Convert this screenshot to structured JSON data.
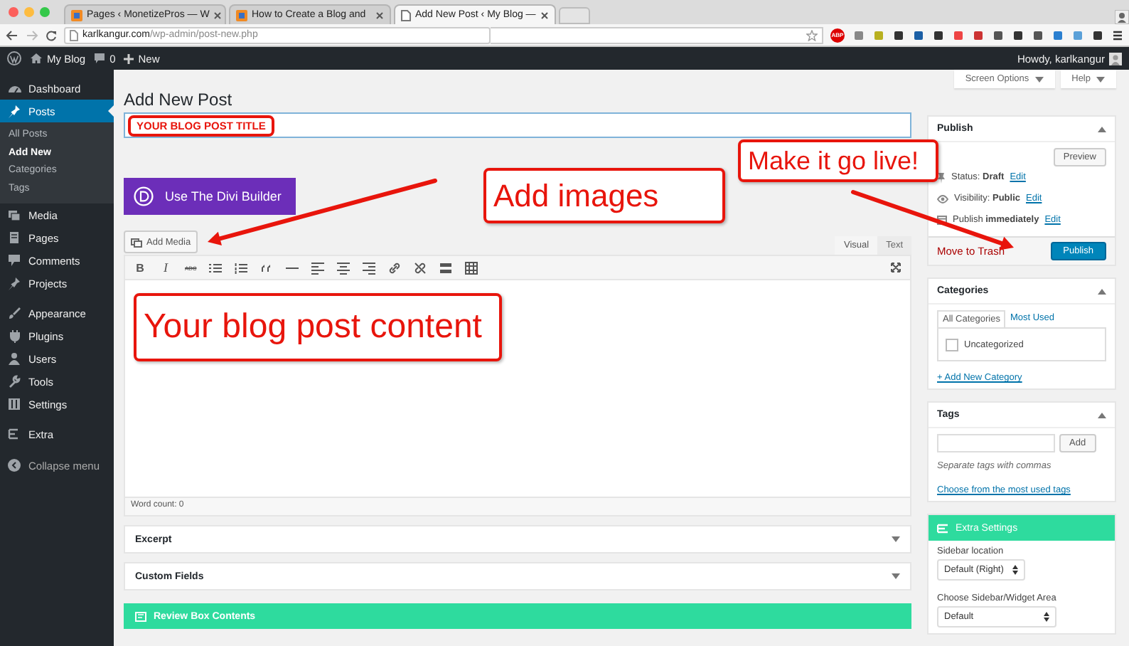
{
  "browser": {
    "tabs": [
      {
        "label": "Pages ‹ MonetizePros — W",
        "selected": false
      },
      {
        "label": "How to Create a Blog and",
        "selected": false
      },
      {
        "label": "Add New Post ‹ My Blog —",
        "selected": true
      }
    ],
    "url_host": "karlkangur.com",
    "url_path": "/wp-admin/post-new.php",
    "badge": "ABP"
  },
  "admin_bar": {
    "site": "My Blog",
    "comments": "0",
    "new": "New",
    "greeting": "Howdy, karlkangur"
  },
  "sidebar": {
    "items": [
      {
        "label": "Dashboard",
        "selected": false
      },
      {
        "label": "Posts",
        "selected": true,
        "children": [
          {
            "label": "All Posts",
            "selected": false
          },
          {
            "label": "Add New",
            "selected": true
          },
          {
            "label": "Categories",
            "selected": false
          },
          {
            "label": "Tags",
            "selected": false
          }
        ]
      },
      {
        "label": "Media",
        "selected": false
      },
      {
        "label": "Pages",
        "selected": false
      },
      {
        "label": "Comments",
        "selected": false
      },
      {
        "label": "Projects",
        "selected": false
      },
      {
        "label": "Appearance",
        "selected": false
      },
      {
        "label": "Plugins",
        "selected": false
      },
      {
        "label": "Users",
        "selected": false
      },
      {
        "label": "Tools",
        "selected": false
      },
      {
        "label": "Settings",
        "selected": false
      },
      {
        "label": "Extra",
        "selected": false
      }
    ],
    "collapse": "Collapse menu"
  },
  "screen_meta": [
    "Screen Options",
    "Help"
  ],
  "page_title": "Add New Post",
  "divi_button": "Use The Divi Builder",
  "add_media": "Add Media",
  "editor_tabs": [
    {
      "label": "Visual",
      "selected": true
    },
    {
      "label": "Text",
      "selected": false
    }
  ],
  "toolbar": [
    {
      "kind": "bold",
      "label": "B"
    },
    {
      "kind": "italic",
      "label": "I"
    },
    {
      "kind": "strike",
      "label": "ABC"
    },
    {
      "kind": "bullets"
    },
    {
      "kind": "numbers"
    },
    {
      "kind": "quote"
    },
    {
      "kind": "rule"
    },
    {
      "kind": "align-left"
    },
    {
      "kind": "align-center"
    },
    {
      "kind": "align-right"
    },
    {
      "kind": "link"
    },
    {
      "kind": "unlink"
    },
    {
      "kind": "more"
    },
    {
      "kind": "sink"
    }
  ],
  "word_count": "Word count: 0",
  "metaboxes": [
    {
      "kind": "plain",
      "title": "Excerpt"
    },
    {
      "kind": "plain",
      "title": "Custom Fields"
    },
    {
      "kind": "accent",
      "title": "Review Box Contents"
    }
  ],
  "publish": {
    "title": "Publish",
    "preview": "Preview",
    "rows": [
      {
        "text": "Status: **Draft**",
        "link": "Edit"
      },
      {
        "text": "Visibility: **Public**",
        "link": "Edit"
      },
      {
        "text": "Publish **immediately**",
        "link": "Edit"
      }
    ],
    "trash": "Move to Trash",
    "button": "Publish"
  },
  "categories": {
    "title": "Categories",
    "tabs": [
      {
        "label": "All Categories",
        "selected": true
      },
      {
        "label": "Most Used",
        "selected": false
      }
    ],
    "items": [
      {
        "label": "Uncategorized",
        "checked": false
      }
    ],
    "add_link": "+ Add New Category"
  },
  "tags": {
    "title": "Tags",
    "button": "Add",
    "hint": "Separate tags with commas",
    "link": "Choose from the most used tags"
  },
  "extra_settings": {
    "title": "Extra Settings",
    "fields": [
      {
        "label": "Sidebar location",
        "value": "Default (Right)"
      },
      {
        "label": "Choose Sidebar/Widget Area",
        "value": "Default"
      }
    ]
  },
  "annotations": [
    {
      "kind": "highlight",
      "text": "YOUR BLOG POST TITLE"
    },
    {
      "kind": "callout",
      "text": "Add images"
    },
    {
      "kind": "callout",
      "text": "Make it go live!"
    },
    {
      "kind": "callout",
      "text": "Your blog post content"
    }
  ]
}
